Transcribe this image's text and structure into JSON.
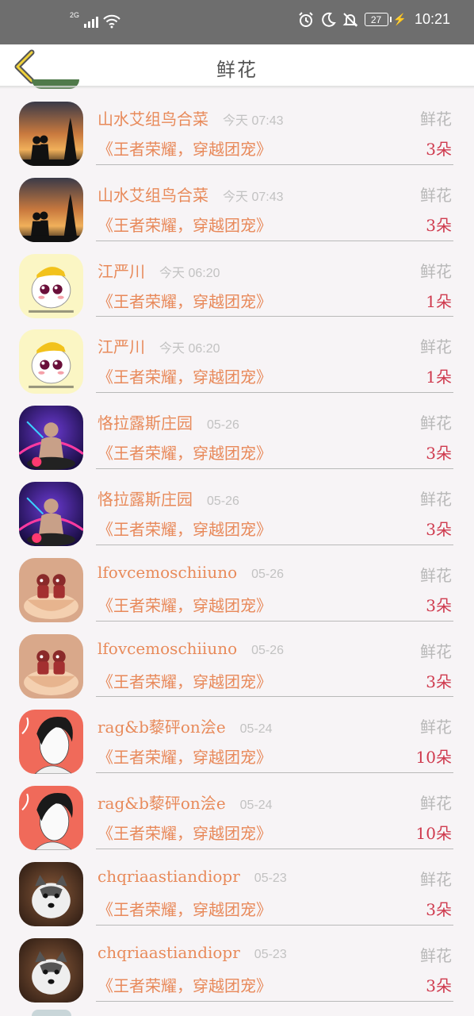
{
  "status_bar": {
    "network": "2G",
    "battery": "27",
    "time": "10:21"
  },
  "header": {
    "title": "鲜花"
  },
  "gift_label": "鲜花",
  "rows": [
    {
      "name": "山水艾组鸟合菜",
      "time": "今天 07:43",
      "title": "《王者荣耀，穿越团宠》",
      "count": "3朵",
      "avatar": "sunset-couple"
    },
    {
      "name": "山水艾组鸟合菜",
      "time": "今天 07:43",
      "title": "《王者荣耀，穿越团宠》",
      "count": "3朵",
      "avatar": "sunset-couple"
    },
    {
      "name": "江严川",
      "time": "今天 06:20",
      "title": "《王者荣耀，穿越团宠》",
      "count": "1朵",
      "avatar": "cartoon-bun"
    },
    {
      "name": "江严川",
      "time": "今天 06:20",
      "title": "《王者荣耀，穿越团宠》",
      "count": "1朵",
      "avatar": "cartoon-bun"
    },
    {
      "name": "恪拉露斯庄园",
      "time": "05-26",
      "title": "《王者荣耀，穿越团宠》",
      "count": "3朵",
      "avatar": "dj-neon"
    },
    {
      "name": "恪拉露斯庄园",
      "time": "05-26",
      "title": "《王者荣耀，穿越团宠》",
      "count": "3朵",
      "avatar": "dj-neon"
    },
    {
      "name": "lfovcemoschiiuno",
      "time": "05-26",
      "title": "《王者荣耀，穿越团宠》",
      "count": "3朵",
      "avatar": "cup-dolls"
    },
    {
      "name": "lfovcemoschiiuno",
      "time": "05-26",
      "title": "《王者荣耀，穿越团宠》",
      "count": "3朵",
      "avatar": "cup-dolls"
    },
    {
      "name": "rag&b藜砰on浍e",
      "time": "05-24",
      "title": "《王者荣耀，穿越团宠》",
      "count": "10朵",
      "avatar": "anime-boy"
    },
    {
      "name": "rag&b藜砰on浍e",
      "time": "05-24",
      "title": "《王者荣耀，穿越团宠》",
      "count": "10朵",
      "avatar": "anime-boy"
    },
    {
      "name": "chqriaastiandiopr",
      "time": "05-23",
      "title": "《王者荣耀，穿越团宠》",
      "count": "3朵",
      "avatar": "husky-puppy"
    },
    {
      "name": "chqriaastiandiopr",
      "time": "05-23",
      "title": "《王者荣耀，穿越团宠》",
      "count": "3朵",
      "avatar": "husky-puppy"
    }
  ]
}
